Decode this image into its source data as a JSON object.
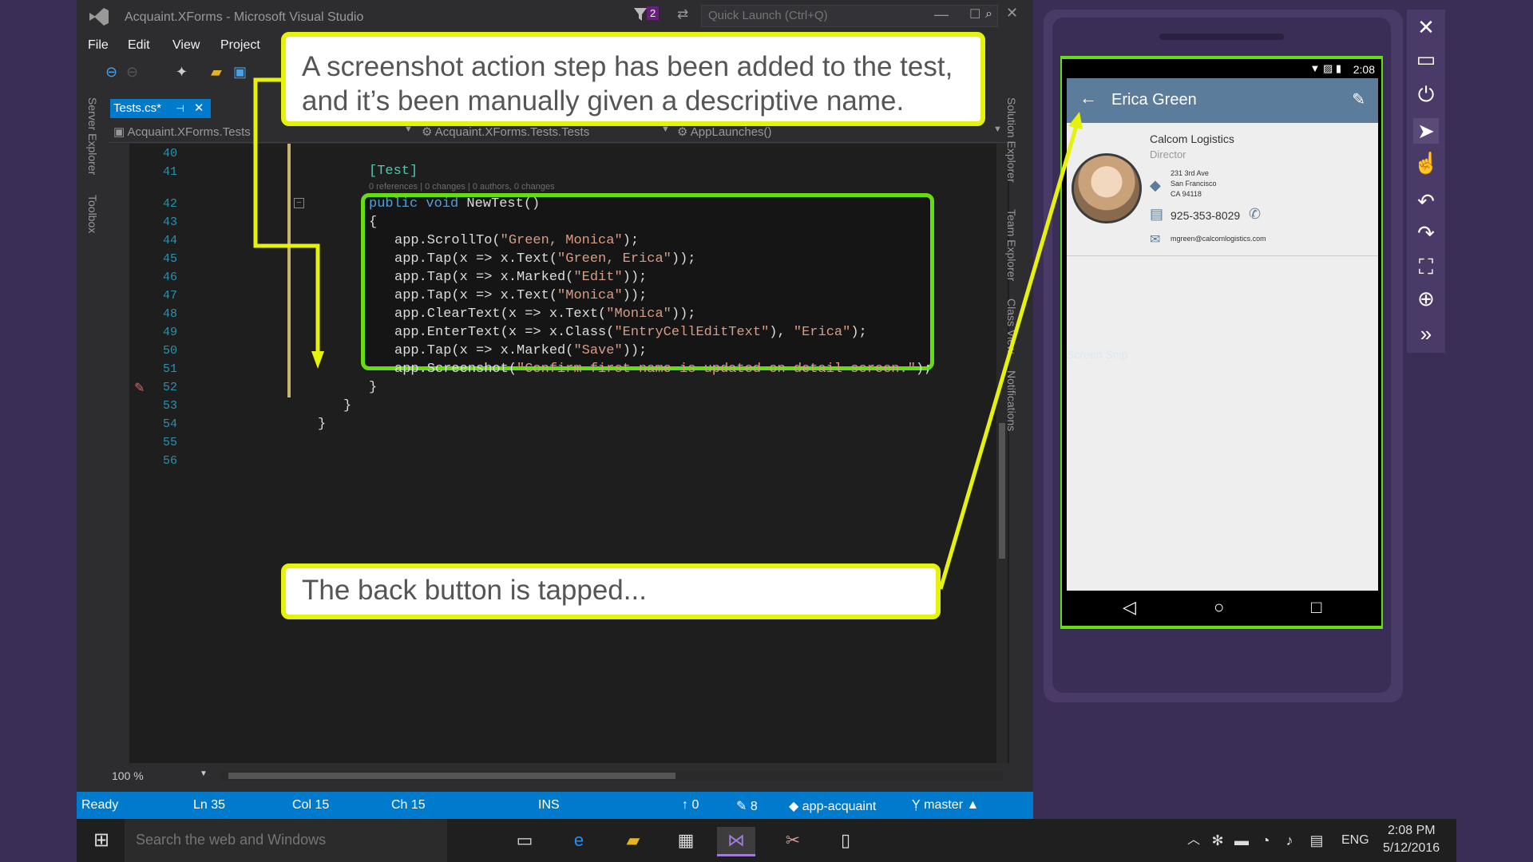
{
  "vs": {
    "title": "Acquaint.XForms - Microsoft Visual Studio",
    "filter_count": "2",
    "quick_launch_placeholder": "Quick Launch (Ctrl+Q)",
    "menu": [
      "File",
      "Edit",
      "View",
      "Project"
    ],
    "left_rail": [
      "Server Explorer",
      "Toolbox"
    ],
    "right_rail": [
      "Solution Explorer",
      "Team Explorer",
      "Class View",
      "Notifications"
    ],
    "tab_label": "Tests.cs*",
    "nav": {
      "project": "Acquaint.XForms.Tests",
      "class": "Acquaint.XForms.Tests.Tests",
      "member": "AppLaunches()"
    },
    "zoom": "100 %",
    "status": {
      "ready": "Ready",
      "ln": "Ln 35",
      "col": "Col 15",
      "ch": "Ch 15",
      "ins": "INS",
      "up": "0",
      "pencil": "8",
      "repo": "app-acquaint",
      "branch": "master"
    },
    "line_numbers": [
      "40",
      "41",
      "42",
      "43",
      "44",
      "45",
      "46",
      "47",
      "48",
      "49",
      "50",
      "51",
      "52",
      "53",
      "54",
      "55",
      "56"
    ],
    "codelens": "0 references | 0 changes | 0 authors, 0 changes",
    "code": {
      "attr": "[Test]",
      "l42_kw": "public void",
      "l42_rest": " NewTest()",
      "l43": "{",
      "l44a": "app.ScrollTo(",
      "l44s": "\"Green, Monica\"",
      "l44b": ");",
      "l45a": "app.Tap(x => x.Text(",
      "l45s": "\"Green, Erica\"",
      "l45b": "));",
      "l46a": "app.Tap(x => x.Marked(",
      "l46s": "\"Edit\"",
      "l46b": "));",
      "l47a": "app.Tap(x => x.Text(",
      "l47s": "\"Monica\"",
      "l47b": "));",
      "l48a": "app.ClearText(x => x.Text(",
      "l48s": "\"Monica\"",
      "l48b": "));",
      "l49a": "app.EnterText(x => x.Class(",
      "l49s": "\"EntryCellEditText\"",
      "l49b": "), ",
      "l49s2": "\"Erica\"",
      "l49c": ");",
      "l50a": "app.Tap(x => x.Marked(",
      "l50s": "\"Save\"",
      "l50b": "));",
      "l51a": "app.Screenshot(",
      "l51s": "\"Confirm first name is updated on detail screen.\"",
      "l51b": ");",
      "l52": "}",
      "l53": "}",
      "l54": "}"
    }
  },
  "callouts": {
    "top": "A screenshot action step has been added to the test, and it’s been manually given a descriptive name.",
    "bottom": "The back button is tapped..."
  },
  "phone": {
    "time": "2:08",
    "title": "Erica Green",
    "company": "Calcom Logistics",
    "job_title": "Director",
    "address": [
      "231 3rd Ave",
      "San Francisco",
      "CA 94118"
    ],
    "phone": "925-353-8029",
    "email": "mgreen@calcomlogistics.com",
    "ghost_text": "Screen Snip"
  },
  "taskbar": {
    "search_placeholder": "Search the web and Windows",
    "lang": "ENG",
    "time": "2:08 PM",
    "date": "5/12/2016"
  },
  "colors": {
    "accent": "#007acc",
    "callout_border": "#e6f20a",
    "highlight_border": "#66dd11",
    "appbar": "#5b7c9a",
    "editor_bg": "#1e1e1e"
  }
}
